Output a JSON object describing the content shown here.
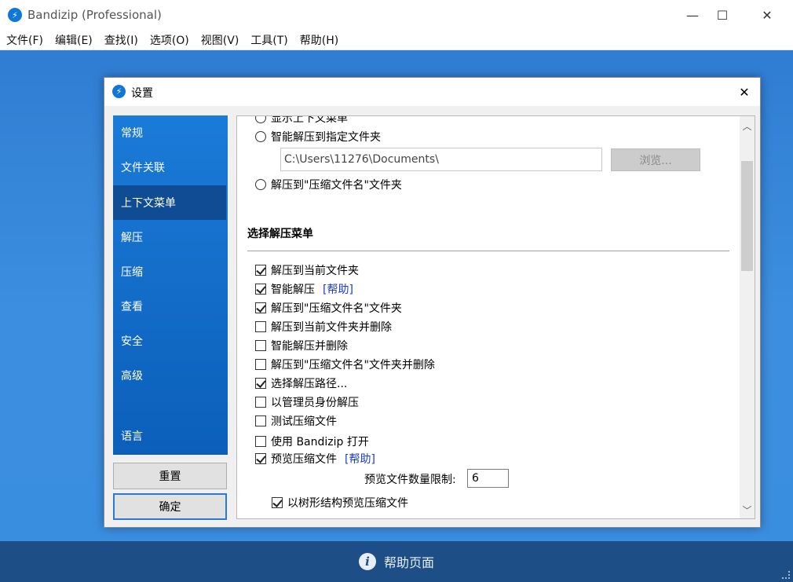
{
  "window": {
    "title": "Bandizip (Professional)",
    "icon": "bandizip-logo-icon",
    "controls": {
      "minimize": "—",
      "maximize": "☐",
      "close": "✕"
    }
  },
  "menubar": [
    "文件(F)",
    "编辑(E)",
    "查找(I)",
    "选项(O)",
    "视图(V)",
    "工具(T)",
    "帮助(H)"
  ],
  "dialog": {
    "title": "设置",
    "close": "✕",
    "sidebar": [
      {
        "label": "常规",
        "active": false
      },
      {
        "label": "文件关联",
        "active": false
      },
      {
        "label": "上下文菜单",
        "active": true
      },
      {
        "label": "解压",
        "active": false
      },
      {
        "label": "压缩",
        "active": false
      },
      {
        "label": "查看",
        "active": false
      },
      {
        "label": "安全",
        "active": false
      },
      {
        "label": "高级",
        "active": false
      },
      {
        "label": "语言",
        "active": false
      }
    ],
    "buttons": {
      "reset": "重置",
      "ok": "确定"
    },
    "panel": {
      "partial_option": "显示上下文菜单",
      "radio_smart_extract_folder": "智能解压到指定文件夹",
      "path_value": "C:\\Users\\11276\\Documents\\",
      "browse_label": "浏览...",
      "radio_extract_to_name": "解压到\"压缩文件名\"文件夹",
      "section_title": "选择解压菜单",
      "checkboxes": [
        {
          "label": "解压到当前文件夹",
          "checked": true
        },
        {
          "label": "智能解压",
          "checked": true,
          "link": "[帮助]"
        },
        {
          "label": "解压到\"压缩文件名\"文件夹",
          "checked": true
        },
        {
          "label": "解压到当前文件夹并删除",
          "checked": false
        },
        {
          "label": "智能解压并删除",
          "checked": false
        },
        {
          "label": "解压到\"压缩文件名\"文件夹并删除",
          "checked": false
        },
        {
          "label": "选择解压路径...",
          "checked": true
        },
        {
          "label": "以管理员身份解压",
          "checked": false
        },
        {
          "label": "测试压缩文件",
          "checked": false
        },
        {
          "label": "使用 Bandizip 打开",
          "checked": false
        },
        {
          "label": "预览压缩文件",
          "checked": true,
          "link": "[帮助]"
        }
      ],
      "limit_label": "预览文件数量限制:",
      "limit_value": "6",
      "tree_preview": {
        "label": "以树形结构预览压缩文件",
        "checked": true
      }
    }
  },
  "bottombar": {
    "label": "帮助页面",
    "icon": "info-icon"
  }
}
